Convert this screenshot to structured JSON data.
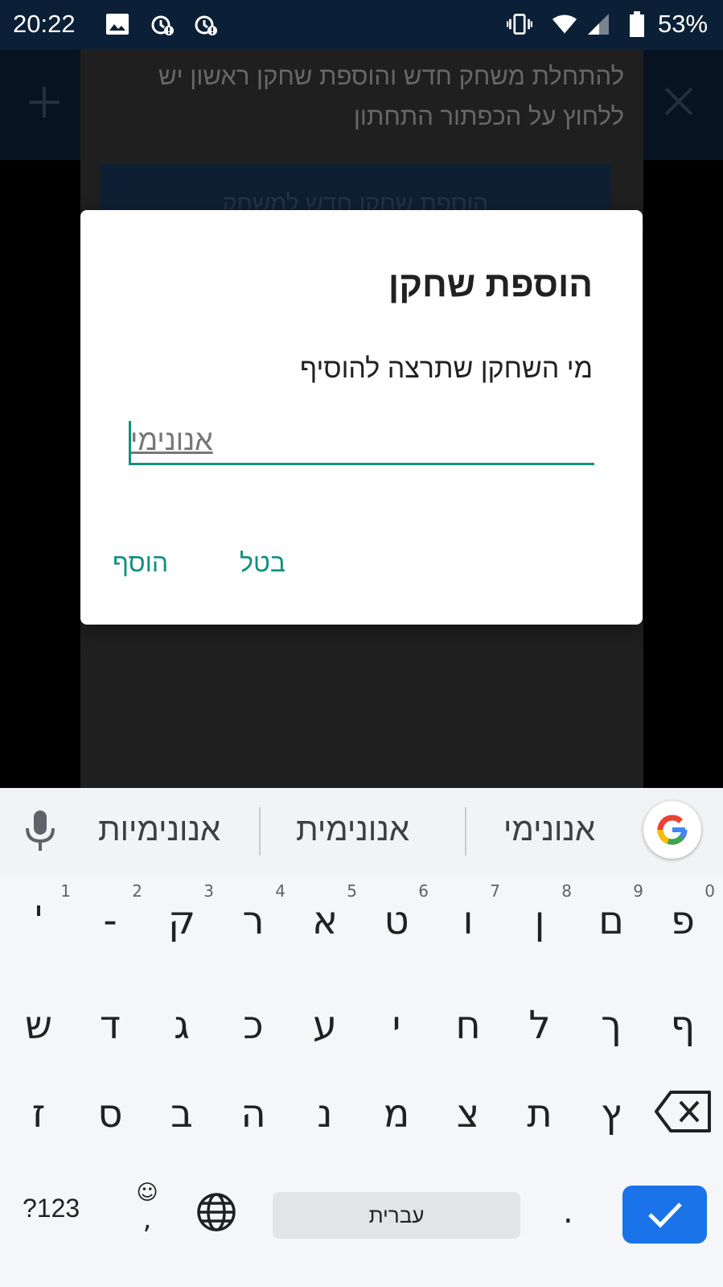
{
  "status_bar": {
    "time": "20:22",
    "battery": "53%"
  },
  "background": {
    "instruction": "להתחלת משחק חדש והוספת שחקן ראשון יש ללחוץ על הכפתור התחתון",
    "button_label": "הוספת שחקן חדש למשחק"
  },
  "dialog": {
    "title": "הוספת שחקן",
    "message": "מי השחקן שתרצה להוסיף",
    "input_value": "אנונימי",
    "cancel_label": "בטל",
    "add_label": "הוסף"
  },
  "keyboard": {
    "suggestions": [
      "אנונימי",
      "אנונימית",
      "אנונימיות"
    ],
    "row1": [
      {
        "key": "פ",
        "hint": "0"
      },
      {
        "key": "ם",
        "hint": "9"
      },
      {
        "key": "ן",
        "hint": "8"
      },
      {
        "key": "ו",
        "hint": "7"
      },
      {
        "key": "ט",
        "hint": "6"
      },
      {
        "key": "א",
        "hint": "5"
      },
      {
        "key": "ר",
        "hint": "4"
      },
      {
        "key": "ק",
        "hint": "3"
      },
      {
        "key": "-",
        "hint": "2"
      },
      {
        "key": "'",
        "hint": "1"
      }
    ],
    "row2": [
      "ף",
      "ך",
      "ל",
      "ח",
      "י",
      "ע",
      "כ",
      "ג",
      "ד",
      "ש"
    ],
    "row3": [
      "ץ",
      "ת",
      "צ",
      "מ",
      "נ",
      "ה",
      "ב",
      "ס",
      "ז"
    ],
    "symbols_label": "?123",
    "comma": ",",
    "space_label": "עברית",
    "period": ".",
    "accent_color": "#1a73e8",
    "dialog_accent_color": "#13907f"
  }
}
